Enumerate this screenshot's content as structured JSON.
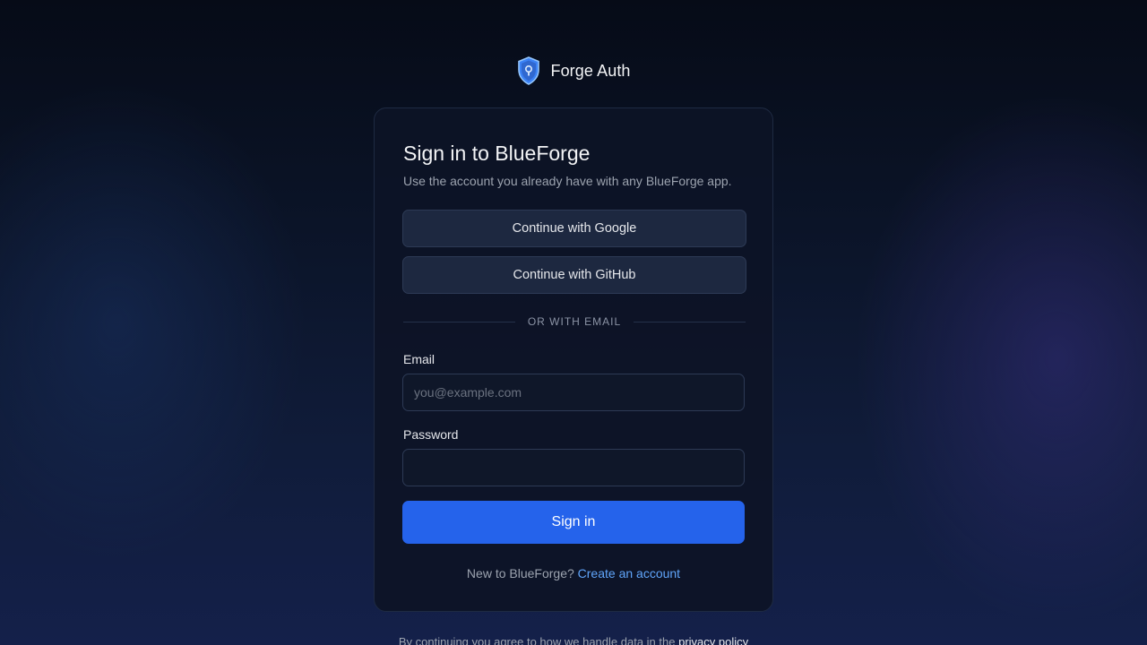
{
  "brand": {
    "name": "Forge Auth",
    "icon": "shield-lock-icon"
  },
  "card": {
    "title": "Sign in to BlueForge",
    "subtitle": "Use the account you already have with any BlueForge app.",
    "oauth": {
      "google_label": "Continue with Google",
      "github_label": "Continue with GitHub"
    },
    "divider_text": "OR WITH EMAIL",
    "email": {
      "label": "Email",
      "placeholder": "you@example.com",
      "value": ""
    },
    "password": {
      "label": "Password",
      "placeholder": "",
      "value": ""
    },
    "submit_label": "Sign in",
    "signup": {
      "prompt": "New to BlueForge?",
      "link_label": "Create an account"
    }
  },
  "footer": {
    "text": "By continuing you agree to how we handle data in the",
    "link_label": "privacy policy"
  },
  "colors": {
    "accent": "#2563eb",
    "link": "#60a5fa",
    "card_bg": "#0d1426"
  }
}
